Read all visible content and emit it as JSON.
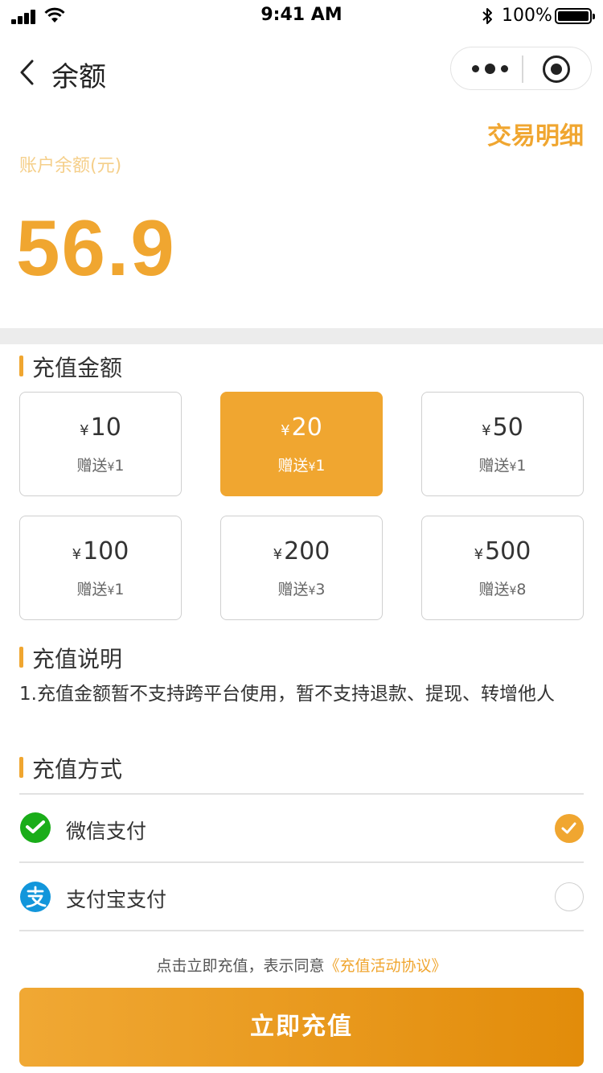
{
  "status_bar": {
    "time": "9:41 AM",
    "battery": "100%"
  },
  "nav": {
    "title": "余额"
  },
  "balance": {
    "tx_detail_label": "交易明细",
    "label": "账户余额(元)",
    "amount": "56.9"
  },
  "recharge": {
    "heading": "充值金额",
    "currency_symbol": "¥",
    "bonus_prefix": "赠送",
    "options": [
      {
        "amount": "10",
        "bonus": "1",
        "selected": false
      },
      {
        "amount": "20",
        "bonus": "1",
        "selected": true
      },
      {
        "amount": "50",
        "bonus": "1",
        "selected": false
      },
      {
        "amount": "100",
        "bonus": "1",
        "selected": false
      },
      {
        "amount": "200",
        "bonus": "3",
        "selected": false
      },
      {
        "amount": "500",
        "bonus": "8",
        "selected": false
      }
    ]
  },
  "instructions": {
    "heading": "充值说明",
    "text": "1.充值金额暂不支持跨平台使用，暂不支持退款、提现、转增他人"
  },
  "payment": {
    "heading": "充值方式",
    "methods": [
      {
        "label": "微信支付",
        "icon": "wechat-pay-icon",
        "selected": true
      },
      {
        "label": "支付宝支付",
        "icon": "alipay-icon",
        "selected": false
      }
    ]
  },
  "agreement": {
    "prefix": "点击立即充值，表示同意",
    "link": "《充值活动协议》"
  },
  "cta_label": "立即充值",
  "colors": {
    "accent": "#f0a630",
    "wechat_green": "#1aad19",
    "alipay_blue": "#1296db"
  }
}
